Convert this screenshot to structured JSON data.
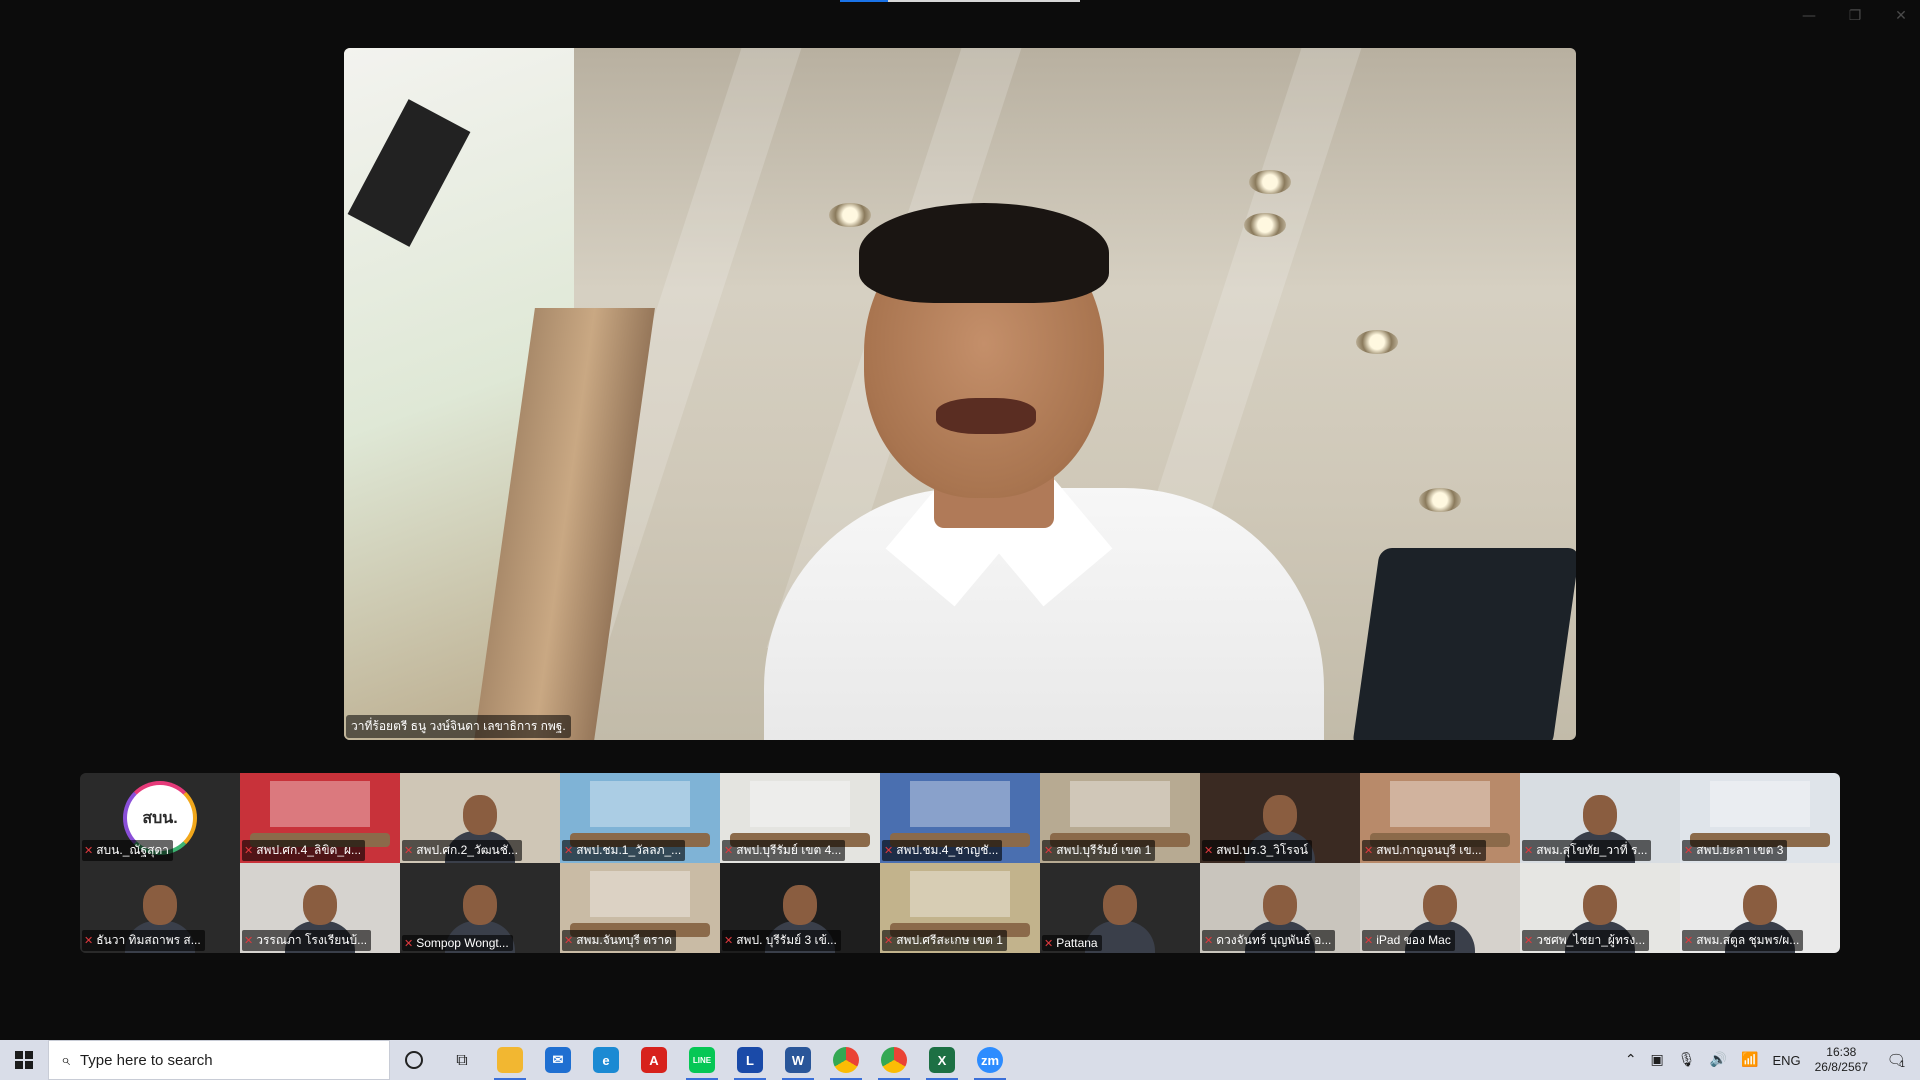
{
  "window": {
    "minimize_icon": "—",
    "restore_icon": "❐",
    "close_icon": "✕"
  },
  "speaker": {
    "name": "วาที่ร้อยตรี ธนู วงษ์จินดา เลขาธิการ กพฐ."
  },
  "gallery": {
    "participants": [
      {
        "name": "สบน._ณัฐสุดา",
        "bg": "#2a2a2a",
        "kind": "logo",
        "logo_text": "สบน."
      },
      {
        "name": "สพป.ศก.4_ลิขิต_ผ...",
        "bg": "#c8323a",
        "kind": "room"
      },
      {
        "name": "สพป.ศก.2_วัฒนชั...",
        "bg": "#cfc6b6",
        "kind": "person"
      },
      {
        "name": "สพป.ชม.1_วัลลภ_...",
        "bg": "#7fb3d6",
        "kind": "room"
      },
      {
        "name": "สพป.บุรีรัมย์ เขต 4...",
        "bg": "#e4e4e0",
        "kind": "room"
      },
      {
        "name": "สพป.ชม.4_ชาญชั...",
        "bg": "#4a6fb0",
        "kind": "room"
      },
      {
        "name": "สพป.บุรีรัมย์ เขต 1",
        "bg": "#b7aa92",
        "kind": "room"
      },
      {
        "name": "สพป.บร.3_วิโรจน์",
        "bg": "#3a2a22",
        "kind": "person"
      },
      {
        "name": "สพป.กาญจนบุรี เข...",
        "bg": "#b88a6a",
        "kind": "room"
      },
      {
        "name": "สพม.สุโขทัย_วาที่ ร...",
        "bg": "#d8dde2",
        "kind": "person"
      },
      {
        "name": "สพป.ยะลา เขต 3",
        "bg": "#dfe4ea",
        "kind": "room"
      },
      {
        "name": "ธันวา ทิมสถาพร ส...",
        "bg": "#2a2a2a",
        "kind": "person"
      },
      {
        "name": "วรรณภา โรงเรียนบ้...",
        "bg": "#d6d3cf",
        "kind": "person"
      },
      {
        "name": "Sompop Wongt...",
        "bg": "#2a2a2a",
        "kind": "person"
      },
      {
        "name": "สพม.จันทบุรี ตราด",
        "bg": "#c9bba5",
        "kind": "room"
      },
      {
        "name": "สพป. บุรีรัมย์ 3 เข้...",
        "bg": "#1e1e1e",
        "kind": "person"
      },
      {
        "name": "สพป.ศรีสะเกษ เขต 1",
        "bg": "#c2b38c",
        "kind": "room"
      },
      {
        "name": "Pattana",
        "bg": "#2a2a2a",
        "kind": "person"
      },
      {
        "name": "ดวงจันทร์ บุญพันธ์ อ...",
        "bg": "#c9c5bd",
        "kind": "person"
      },
      {
        "name": "iPad ของ Mac",
        "bg": "#d6d2cc",
        "kind": "person"
      },
      {
        "name": "วชศพ_ไชยา_ผู้ทรง...",
        "bg": "#e6e6e3",
        "kind": "person"
      },
      {
        "name": "สพม.สตูล ชุมพร/ผ...",
        "bg": "#eaeaea",
        "kind": "person"
      }
    ]
  },
  "taskbar": {
    "search_placeholder": "Type here to search",
    "search_icon": "⌕",
    "taskview_icon": "⧉",
    "apps": [
      {
        "name": "file-explorer",
        "label": "",
        "color": "#f2b731",
        "active": true
      },
      {
        "name": "mail",
        "label": "✉",
        "color": "#1f6fd1",
        "active": false
      },
      {
        "name": "edge",
        "label": "e",
        "color": "#1b8ad3",
        "active": false
      },
      {
        "name": "acrobat",
        "label": "A",
        "color": "#d7221c",
        "active": false
      },
      {
        "name": "line",
        "label": "LINE",
        "color": "#06c755",
        "active": true
      },
      {
        "name": "lms",
        "label": "L",
        "color": "#1a4aa8",
        "active": true
      },
      {
        "name": "word",
        "label": "W",
        "color": "#2a5699",
        "active": true
      },
      {
        "name": "chrome",
        "label": "",
        "color": "#4285f4",
        "active": true
      },
      {
        "name": "chrome-2",
        "label": "",
        "color": "#34a853",
        "active": true
      },
      {
        "name": "excel",
        "label": "X",
        "color": "#1d7044",
        "active": true
      },
      {
        "name": "zoom",
        "label": "zm",
        "color": "#2d8cff",
        "active": true
      }
    ],
    "tray": {
      "chevron": "⌃",
      "meet_now": "▣",
      "mic": "🎙",
      "volume": "🔊",
      "network": "📶",
      "language": "ENG",
      "time": "16:38",
      "date": "26/8/2567",
      "notification_icon": "🗨",
      "notification_count": "1"
    }
  }
}
